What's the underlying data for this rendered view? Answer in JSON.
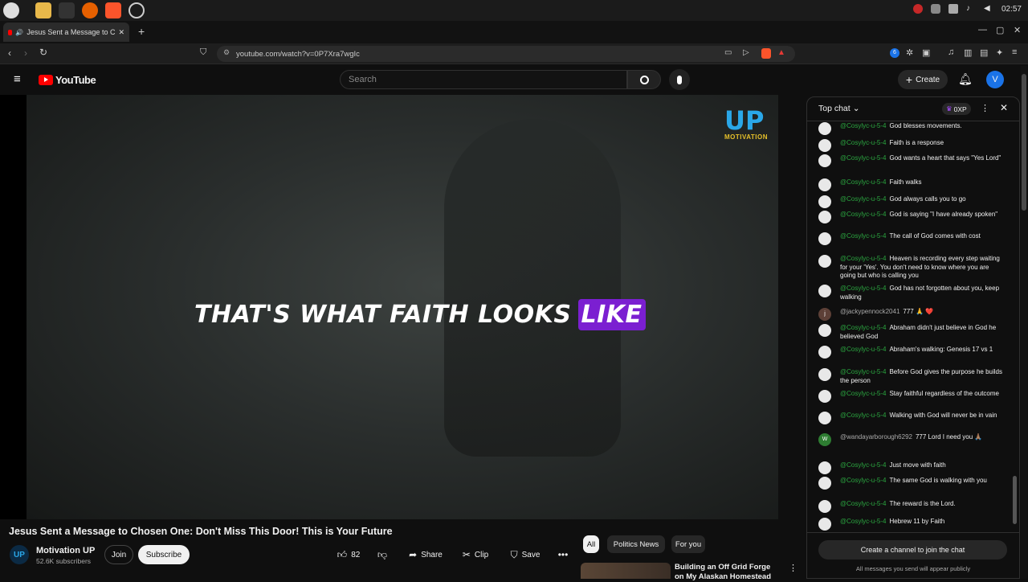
{
  "os": {
    "clock": "02:57"
  },
  "browser": {
    "tab_title": "Jesus Sent a Message to C",
    "url": "youtube.com/watch?v=0P7Xra7wgIc",
    "new_tab": "+",
    "ext_badge": "6"
  },
  "youtube": {
    "logo": "YouTube",
    "search_placeholder": "Search",
    "create_label": "Create",
    "avatar_letter": "V"
  },
  "video": {
    "caption_main": "THAT'S WHAT FAITH LOOKS",
    "caption_highlight": "LIKE",
    "logo_big": "UP",
    "logo_small": "MOTIVATION",
    "watermark": "UP",
    "title": "Jesus Sent a Message to Chosen One: Don't Miss This Door! This is Your Future"
  },
  "channel": {
    "logo": "UP",
    "name": "Motivation UP",
    "subscribers": "52.6K subscribers",
    "join": "Join",
    "subscribe": "Subscribe"
  },
  "actions": {
    "likes": "82",
    "share": "Share",
    "clip": "Clip",
    "save": "Save"
  },
  "chips": [
    "All",
    "Politics News",
    "For you"
  ],
  "recommended": {
    "title": "Building an Off Grid Forge on My Alaskan Homestead"
  },
  "chat": {
    "mode": "Top chat",
    "points": "0XP",
    "messages": [
      {
        "author": "@Cosylyc-u-5-4",
        "text": "God blesses movements.",
        "avatar": ""
      },
      {
        "author": "@Cosylyc-u-5-4",
        "text": "Faith is a response",
        "avatar": ""
      },
      {
        "author": "@Cosylyc-u-5-4",
        "text": "God wants a heart that says \"Yes Lord\"",
        "avatar": ""
      },
      {
        "author": "@Cosylyc-u-5-4",
        "text": "Faith walks",
        "avatar": ""
      },
      {
        "author": "@Cosylyc-u-5-4",
        "text": "God always calls you to go",
        "avatar": ""
      },
      {
        "author": "@Cosylyc-u-5-4",
        "text": "God is saying \"I have already spoken\"",
        "avatar": ""
      },
      {
        "author": "@Cosylyc-u-5-4",
        "text": "The call of God comes with cost",
        "avatar": ""
      },
      {
        "author": "@Cosylyc-u-5-4",
        "text": "Heaven is recording every step waiting for your 'Yes'. You don't need to know where you are going but who is calling you",
        "avatar": ""
      },
      {
        "author": "@Cosylyc-u-5-4",
        "text": "God has not forgotten about you, keep walking",
        "avatar": ""
      },
      {
        "author": "@jackypennock2041",
        "text": "777 🙏 ❤️",
        "avatar": "j"
      },
      {
        "author": "@Cosylyc-u-5-4",
        "text": "Abraham didn't just believe in God he believed God",
        "avatar": ""
      },
      {
        "author": "@Cosylyc-u-5-4",
        "text": "Abraham's walking: Genesis 17 vs 1",
        "avatar": ""
      },
      {
        "author": "@Cosylyc-u-5-4",
        "text": "Before God gives the purpose he builds the person",
        "avatar": ""
      },
      {
        "author": "@Cosylyc-u-5-4",
        "text": "Stay faithful regardless of the outcome",
        "avatar": ""
      },
      {
        "author": "@Cosylyc-u-5-4",
        "text": "Walking with God will never be in vain",
        "avatar": ""
      },
      {
        "author": "@wandayarborough6292",
        "text": "777 Lord I need you 🙏🏽",
        "avatar": "W"
      },
      {
        "author": "@Cosylyc-u-5-4",
        "text": "Just move with faith",
        "avatar": ""
      },
      {
        "author": "@Cosylyc-u-5-4",
        "text": "The same God is walking with you",
        "avatar": ""
      },
      {
        "author": "@Cosylyc-u-5-4",
        "text": "The reward is the Lord.",
        "avatar": ""
      },
      {
        "author": "@Cosylyc-u-5-4",
        "text": "Hebrew 11 by Faith",
        "avatar": ""
      }
    ],
    "join_label": "Create a channel to join the chat",
    "footer_note": "All messages you send will appear publicly"
  }
}
